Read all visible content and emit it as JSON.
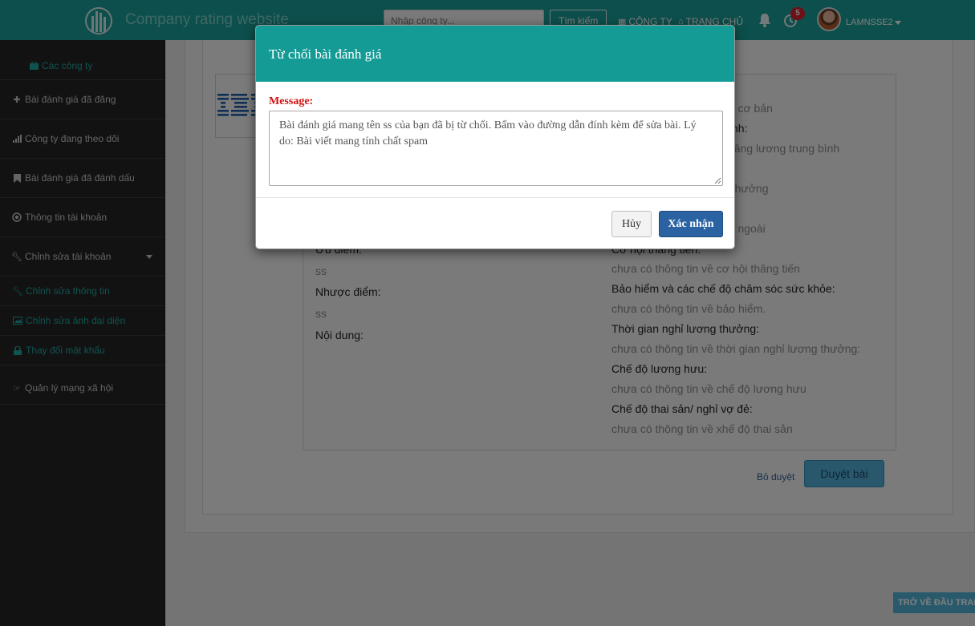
{
  "navbar": {
    "brand": "Company rating website",
    "search_placeholder": "Nhập công ty...",
    "search_button": "Tìm kiếm",
    "link_companies": "CÔNG TY",
    "link_home": "TRANG CHỦ",
    "notification_count": "5",
    "username": "LAMNSSE2",
    "icons": [
      "building-logo-icon",
      "calendar-icon",
      "home-icon",
      "bell-icon",
      "clock-icon",
      "caret-down-icon"
    ]
  },
  "sidebar": {
    "items": [
      {
        "label": "Các công ty",
        "icon": "briefcase-icon"
      },
      {
        "label": "Bài đánh giá đã đăng",
        "icon": "plus-icon"
      },
      {
        "label": "Công ty đang theo dõi",
        "icon": "signal-icon"
      },
      {
        "label": "Bài đánh giá đã đánh dấu",
        "icon": "bookmark-icon"
      },
      {
        "label": "Thông tin tài khoản",
        "icon": "record-icon"
      },
      {
        "label": "Chỉnh sửa tài khoản",
        "icon": "wrench-icon"
      },
      {
        "label": "Chỉnh sửa thông tin",
        "icon": "wrench-icon"
      },
      {
        "label": "Chỉnh sửa ảnh đại diện",
        "icon": "picture-icon"
      },
      {
        "label": "Thay đổi mật khẩu",
        "icon": "lock-icon"
      },
      {
        "label": "Quản lý mạng xã hội",
        "icon": "hand-right-icon"
      }
    ]
  },
  "review": {
    "pros_label": "Ưu điểm:",
    "pros_value": "ss",
    "cons_label": "Nhược điểm:",
    "cons_value": "ss",
    "content_label": "Nội dung:",
    "right_col": [
      {
        "value": "ng cơ bản"
      },
      {
        "label": "nh:"
      },
      {
        "value": "c tăng lương trung bình"
      },
      {
        "value": "g thưởng"
      },
      {
        "value": "ng ngoài"
      },
      {
        "label": "Cơ hội thăng tiến:"
      },
      {
        "value": "chưa có thông tin về cơ hội thăng tiến"
      },
      {
        "label": "Bảo hiểm và các chế độ chăm sóc sức khỏe:"
      },
      {
        "value": "chưa có thông tin về bảo hiểm."
      },
      {
        "label": "Thời gian nghỉ lương thưởng:"
      },
      {
        "value": "chưa có thông tin về thời gian nghỉ lương thưởng:"
      },
      {
        "label": "Chế độ lương hưu:"
      },
      {
        "value": "chưa có thông tin về chế độ lương hưu"
      },
      {
        "label": "Chế độ thai sản/ nghỉ vợ đẻ:"
      },
      {
        "value": "chưa có thông tin về xhế độ thai sản"
      }
    ],
    "reject_link": "Bỏ duyệt",
    "approve_button": "Duyệt bài"
  },
  "back_to_top": "TRỞ VỀ ĐẦU TRANG",
  "modal": {
    "title": "Từ chối bài đánh giá",
    "message_label": "Message:",
    "message_value": "Bài đánh giá mang tên ss của bạn đã bị từ chối. Bấm vào đường dẫn đính kèm để sửa bài. Lý do: Bài viết mang tính chất spam",
    "cancel_button": "Hủy",
    "confirm_button": "Xác nhận"
  },
  "colors": {
    "navbar": "#1b9e98",
    "modal_header": "#159b96",
    "sidebar": "#242424",
    "sidebar_active": "#1ea7a1",
    "confirm_button": "#2a62a2",
    "message_label": "#d41010",
    "badge": "#d9232e"
  }
}
